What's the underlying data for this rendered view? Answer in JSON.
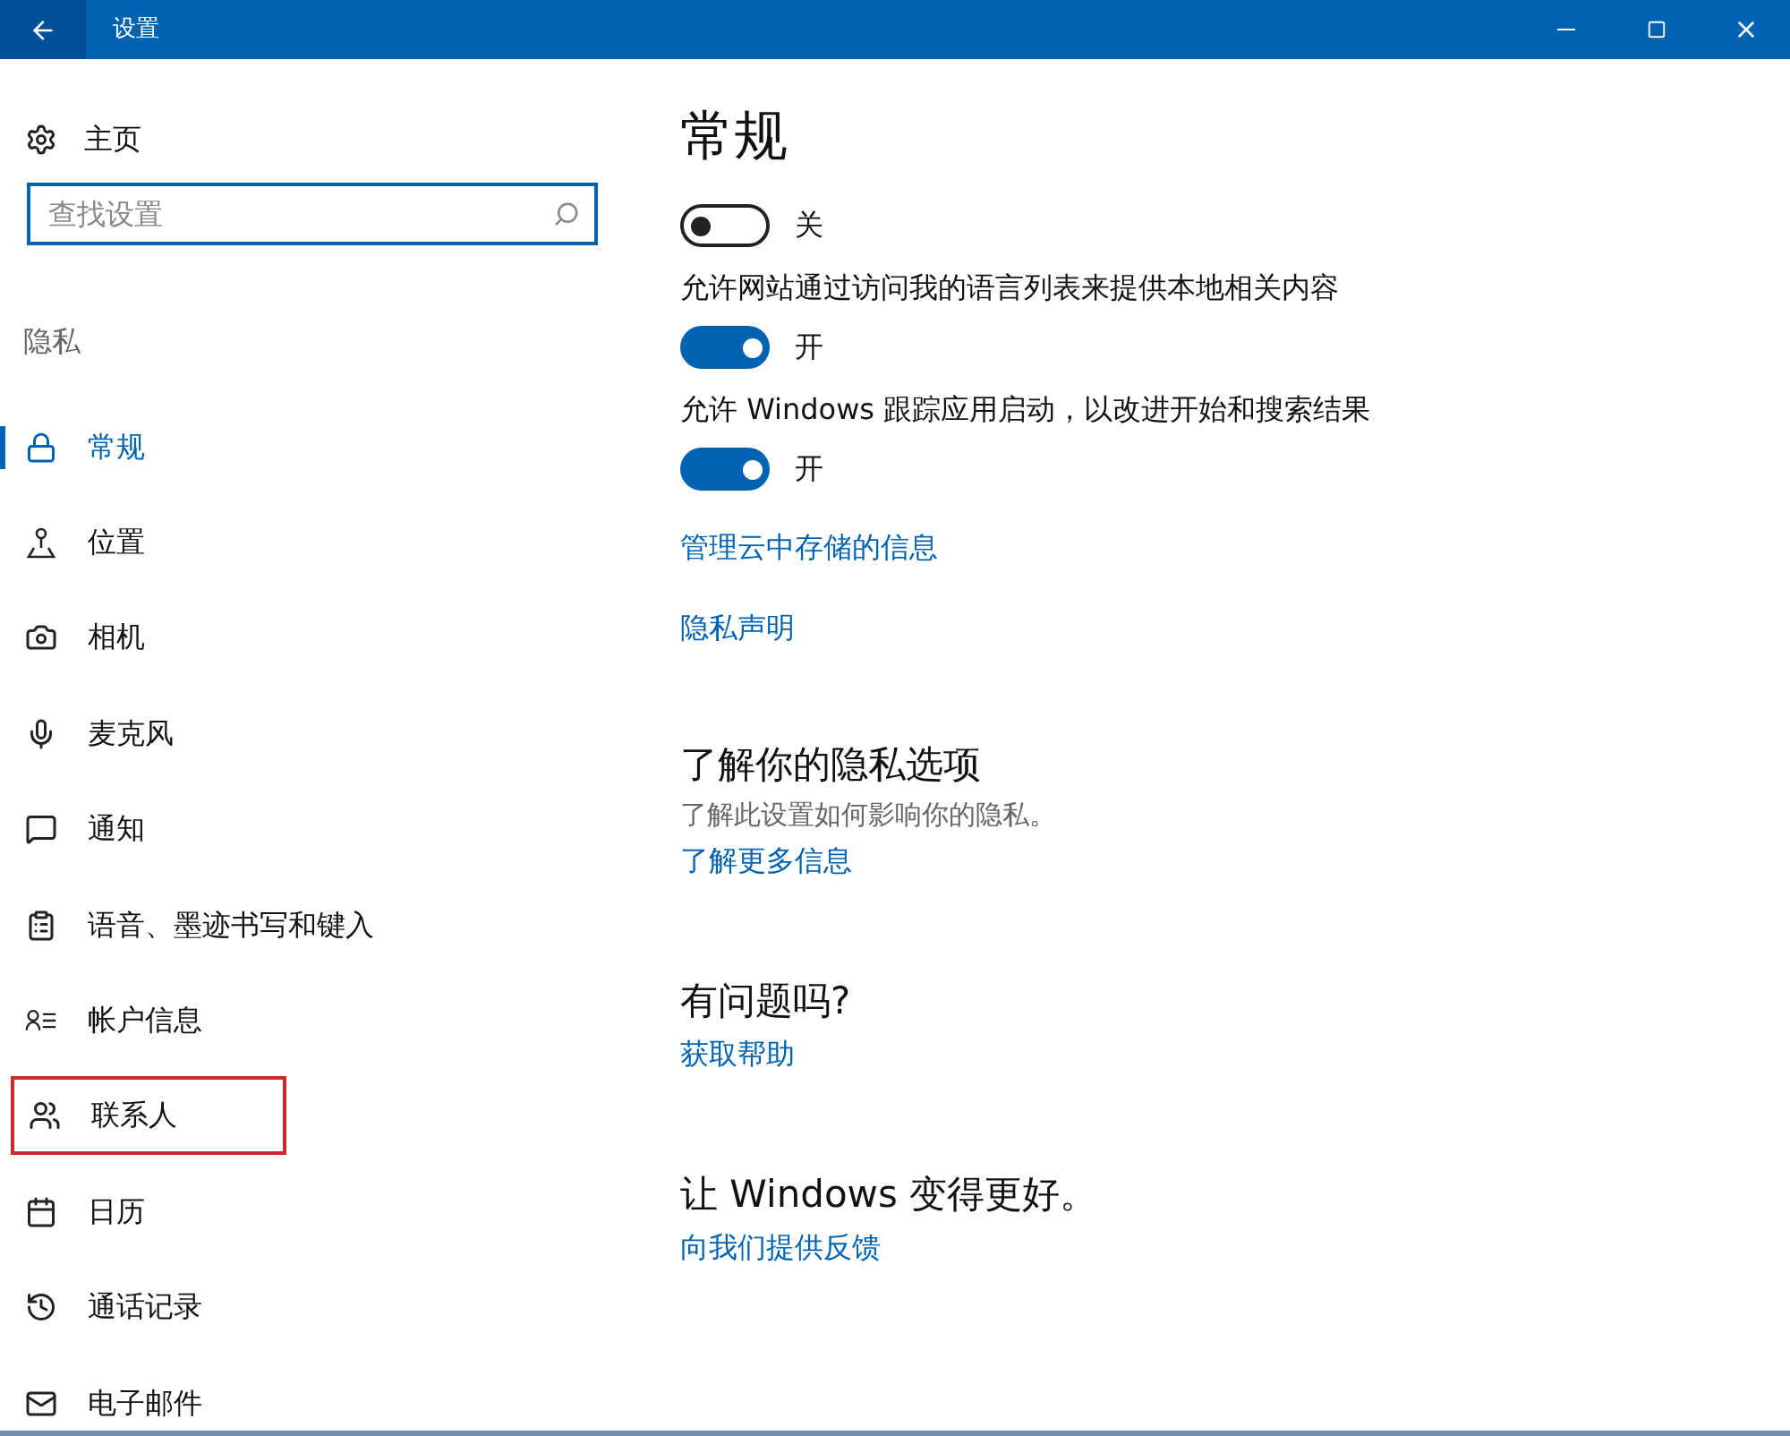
{
  "window": {
    "title": "设置"
  },
  "sidebar": {
    "home": "主页",
    "search": {
      "placeholder": "查找设置"
    },
    "section": "隐私",
    "items": [
      {
        "label": "常规",
        "kind": "lock",
        "selected": true,
        "highlighted": false
      },
      {
        "label": "位置",
        "kind": "location",
        "selected": false,
        "highlighted": false
      },
      {
        "label": "相机",
        "kind": "camera",
        "selected": false,
        "highlighted": false
      },
      {
        "label": "麦克风",
        "kind": "mic",
        "selected": false,
        "highlighted": false
      },
      {
        "label": "通知",
        "kind": "message",
        "selected": false,
        "highlighted": false
      },
      {
        "label": "语音、墨迹书写和键入",
        "kind": "clipboard",
        "selected": false,
        "highlighted": false
      },
      {
        "label": "帐户信息",
        "kind": "account",
        "selected": false,
        "highlighted": false
      },
      {
        "label": "联系人",
        "kind": "contacts",
        "selected": false,
        "highlighted": true
      },
      {
        "label": "日历",
        "kind": "calendar",
        "selected": false,
        "highlighted": false
      },
      {
        "label": "通话记录",
        "kind": "history",
        "selected": false,
        "highlighted": false
      },
      {
        "label": "电子邮件",
        "kind": "mail",
        "selected": false,
        "highlighted": false
      }
    ]
  },
  "main": {
    "title": "常规",
    "toggles": [
      {
        "on": false,
        "state_text": "关"
      },
      {
        "label": "允许网站通过访问我的语言列表来提供本地相关内容",
        "on": true,
        "state_text": "开"
      },
      {
        "label": "允许 Windows 跟踪应用启动，以改进开始和搜索结果",
        "on": true,
        "state_text": "开"
      }
    ],
    "links": [
      "管理云中存储的信息",
      "隐私声明"
    ],
    "sections": [
      {
        "heading": "了解你的隐私选项",
        "text": "了解此设置如何影响你的隐私。",
        "link": "了解更多信息"
      },
      {
        "heading": "有问题吗?",
        "link": "获取帮助"
      },
      {
        "heading": "让 Windows 变得更好。",
        "link": "向我们提供反馈"
      }
    ]
  }
}
